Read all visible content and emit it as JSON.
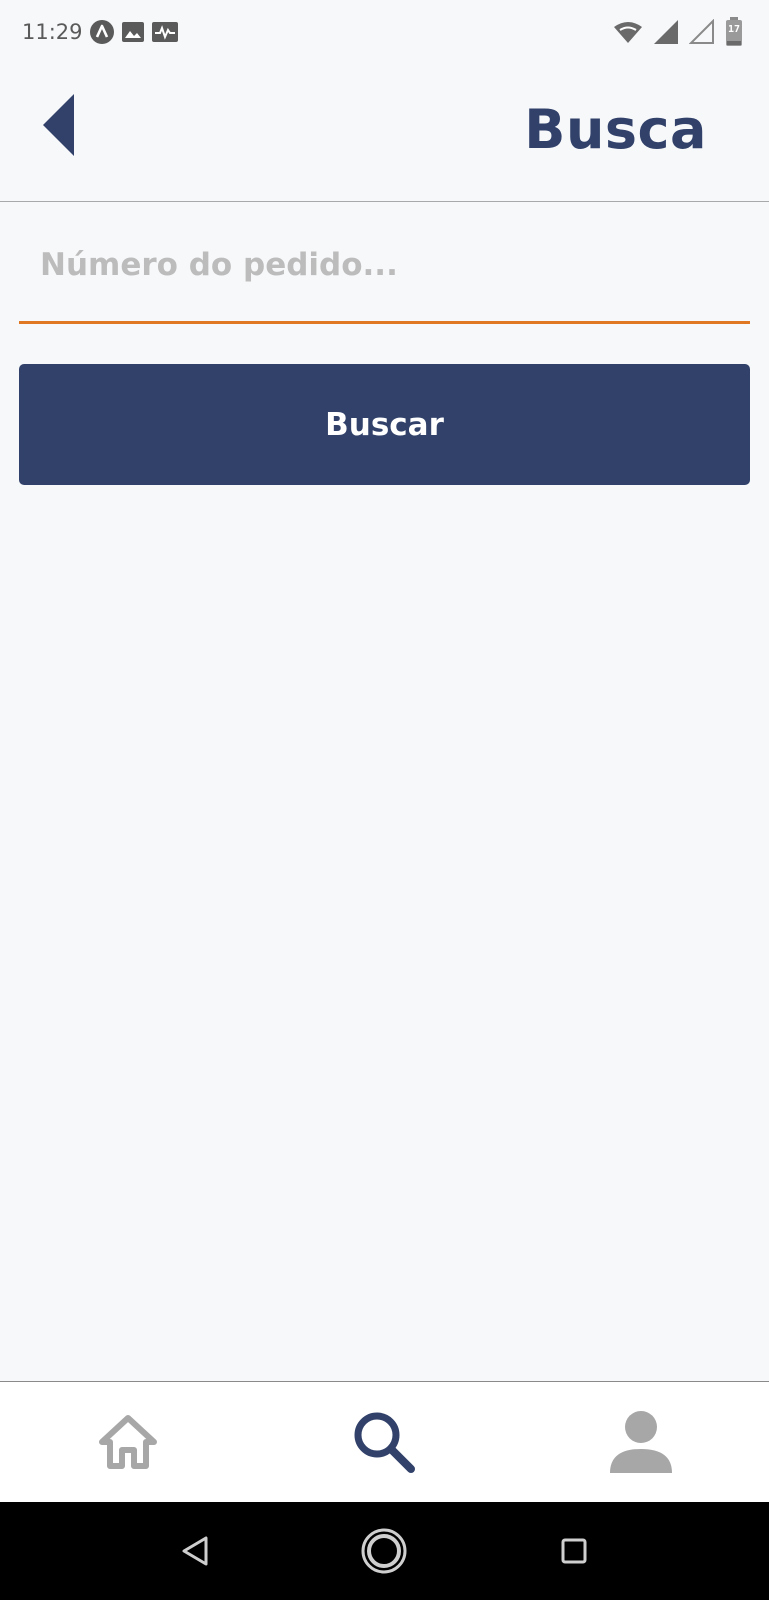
{
  "status_bar": {
    "time": "11:29",
    "battery_level": "17",
    "icons": [
      "app-notification-icon",
      "image-icon",
      "activity-icon",
      "wifi-icon",
      "signal-icon",
      "signal-empty-icon",
      "battery-icon"
    ]
  },
  "header": {
    "title": "Busca",
    "back_icon": "back-arrow-icon"
  },
  "search": {
    "placeholder": "Número do pedido...",
    "value": ""
  },
  "actions": {
    "search_label": "Buscar"
  },
  "bottom_nav": {
    "items": [
      {
        "icon": "home-icon",
        "active": false
      },
      {
        "icon": "search-icon",
        "active": true
      },
      {
        "icon": "profile-icon",
        "active": false
      }
    ]
  },
  "colors": {
    "primary": "#31416a",
    "accent": "#e07722",
    "background": "#f7f8fa",
    "inactive_icon": "#a7a7a7"
  }
}
